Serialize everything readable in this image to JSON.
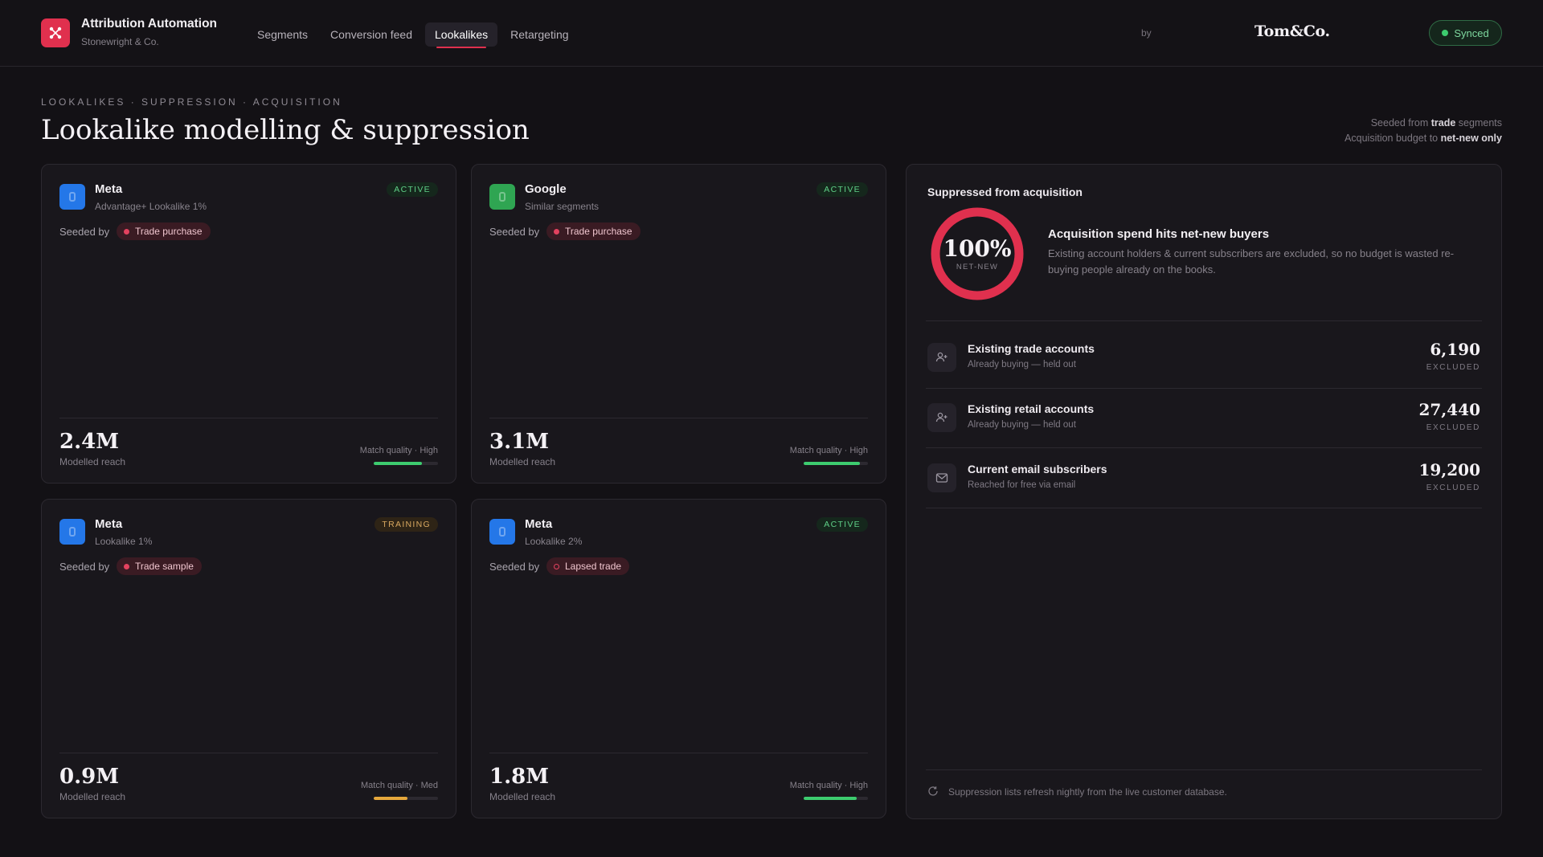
{
  "header": {
    "app_title": "Attribution Automation",
    "app_subtitle": "Stonewright & Co.",
    "nav": [
      {
        "label": "Segments",
        "active": false
      },
      {
        "label": "Conversion feed",
        "active": false
      },
      {
        "label": "Lookalikes",
        "active": true
      },
      {
        "label": "Retargeting",
        "active": false
      }
    ],
    "by_label": "by",
    "partner_logo": "Tom&Co.",
    "sync_status": "Synced",
    "accent_color": "#e0304e"
  },
  "page": {
    "eyebrow": "LOOKALIKES · SUPPRESSION · ACQUISITION",
    "title": "Lookalike modelling & suppression",
    "note_line1_prefix": "Seeded from ",
    "note_line1_bold": "trade",
    "note_line1_suffix": " segments",
    "note_line2_prefix": "Acquisition budget to ",
    "note_line2_bold": "net-new only"
  },
  "cards": [
    {
      "platform": "Meta",
      "platform_icon": "meta-icon",
      "subtitle": "Advantage+ Lookalike 1%",
      "status": "ACTIVE",
      "seeded_label": "Seeded by",
      "seed": "Trade purchase",
      "seed_hollow": false,
      "reach": "2.4M",
      "reach_label": "Modelled reach",
      "match_quality": "Match quality · High",
      "quality_fraction": 0.75,
      "quality_color": "#3dcc6f"
    },
    {
      "platform": "Google",
      "platform_icon": "google-icon",
      "subtitle": "Similar segments",
      "status": "ACTIVE",
      "seeded_label": "Seeded by",
      "seed": "Trade purchase",
      "seed_hollow": false,
      "reach": "3.1M",
      "reach_label": "Modelled reach",
      "match_quality": "Match quality · High",
      "quality_fraction": 0.88,
      "quality_color": "#3dcc6f"
    },
    {
      "platform": "Meta",
      "platform_icon": "meta-icon",
      "subtitle": "Lookalike 1%",
      "status": "TRAINING",
      "seeded_label": "Seeded by",
      "seed": "Trade sample",
      "seed_hollow": false,
      "reach": "0.9M",
      "reach_label": "Modelled reach",
      "match_quality": "Match quality · Med",
      "quality_fraction": 0.52,
      "quality_color": "#e6a83c"
    },
    {
      "platform": "Meta",
      "platform_icon": "meta-icon",
      "subtitle": "Lookalike 2%",
      "status": "ACTIVE",
      "seeded_label": "Seeded by",
      "seed": "Lapsed trade",
      "seed_hollow": true,
      "reach": "1.8M",
      "reach_label": "Modelled reach",
      "match_quality": "Match quality · High",
      "quality_fraction": 0.83,
      "quality_color": "#3dcc6f"
    }
  ],
  "suppression": {
    "title": "Suppressed from acquisition",
    "ring_value": "100%",
    "ring_label": "NET-NEW",
    "ring_fraction": 1.0,
    "hero_title": "Acquisition spend hits net-new buyers",
    "hero_desc": "Existing account holders & current subscribers are excluded, so no budget is wasted re-buying people already on the books.",
    "rows": [
      {
        "icon": "user-plus-icon",
        "title": "Existing trade accounts",
        "sub": "Already buying — held out",
        "count": "6,190",
        "unit": "EXCLUDED"
      },
      {
        "icon": "user-plus-icon",
        "title": "Existing retail accounts",
        "sub": "Already buying — held out",
        "count": "27,440",
        "unit": "EXCLUDED"
      },
      {
        "icon": "mail-icon",
        "title": "Current email subscribers",
        "sub": "Reached for free via email",
        "count": "19,200",
        "unit": "EXCLUDED"
      }
    ],
    "footnote": "Suppression lists refresh nightly from the live customer database."
  }
}
